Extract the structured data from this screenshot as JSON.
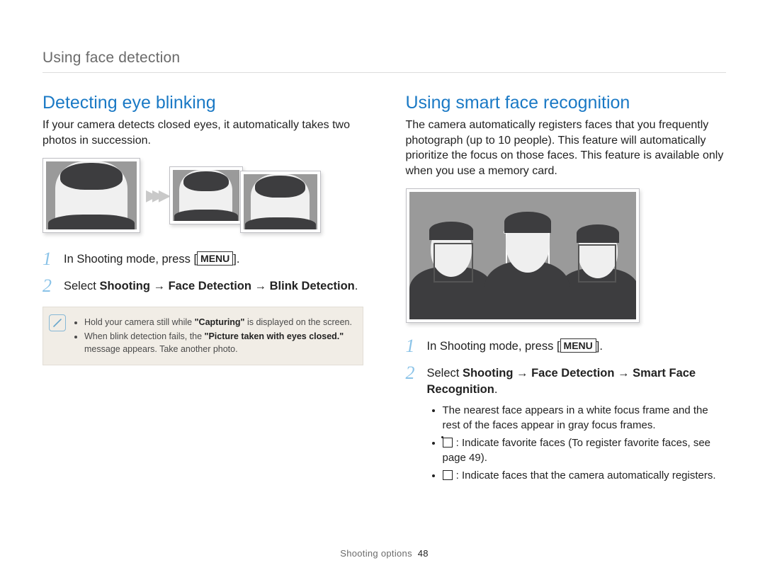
{
  "header": {
    "title": "Using face detection"
  },
  "left": {
    "title": "Detecting eye blinking",
    "intro": "If your camera detects closed eyes, it automatically takes two photos in succession.",
    "steps": [
      {
        "num": "1",
        "pre": "In Shooting mode, press [",
        "key": "MENU",
        "post": "]."
      },
      {
        "num": "2",
        "text_prefix": "Select ",
        "bold": "Shooting → Face Detection → Blink Detection",
        "text_suffix": "."
      }
    ],
    "notes": [
      {
        "pre": "Hold your camera still while ",
        "bold": "\"Capturing\"",
        "post": " is displayed on the screen."
      },
      {
        "pre": "When blink detection fails, the ",
        "bold": "\"Picture taken with eyes closed.\"",
        "post": " message appears. Take another photo."
      }
    ]
  },
  "right": {
    "title": "Using smart face recognition",
    "intro": "The camera automatically registers faces that you frequently photograph (up to 10 people). This feature will automatically prioritize the focus on those faces. This feature is available only when you use a memory card.",
    "steps": [
      {
        "num": "1",
        "pre": "In Shooting mode, press [",
        "key": "MENU",
        "post": "]."
      },
      {
        "num": "2",
        "text_prefix": "Select ",
        "bold": "Shooting → Face Detection → Smart Face Recognition",
        "text_suffix": "."
      }
    ],
    "bullets": [
      {
        "text": "The nearest face appears in a white focus frame and the rest of the faces appear in gray focus frames."
      },
      {
        "icon": "fav",
        "text": " : Indicate favorite faces (To register favorite faces, see page 49)."
      },
      {
        "icon": "auto",
        "text": " : Indicate faces that the camera automatically registers."
      }
    ]
  },
  "footer": {
    "section": "Shooting options",
    "page": "48"
  }
}
